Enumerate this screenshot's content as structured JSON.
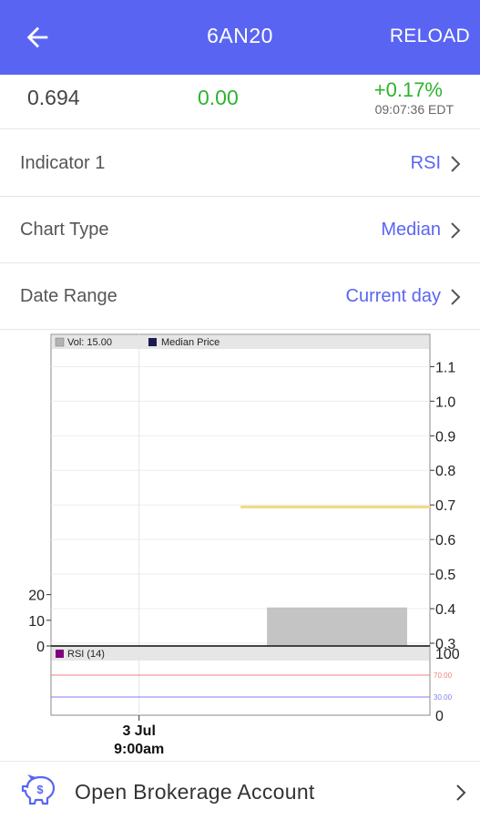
{
  "appbar": {
    "title": "6AN20",
    "reload_label": "RELOAD",
    "back_icon": "arrow-left-icon",
    "background": "#5965f2"
  },
  "quote": {
    "last": "0.694",
    "change": "0.00",
    "change_pct": "+0.17%",
    "time": "09:07:36 EDT",
    "positive_color": "#2db32d"
  },
  "settings": [
    {
      "label": "Indicator 1",
      "value": "RSI"
    },
    {
      "label": "Chart Type",
      "value": "Median"
    },
    {
      "label": "Date Range",
      "value": "Current day"
    }
  ],
  "chart_data": {
    "type": "line",
    "main_panel": {
      "legend": [
        {
          "name": "Vol: 15.00",
          "color": "#b3b3b3"
        },
        {
          "name": "Median Price",
          "color": "#1a1a4d"
        }
      ],
      "y_right_ticks": [
        "1.1",
        "1.0",
        "0.9",
        "0.8",
        "0.7",
        "0.6",
        "0.5",
        "0.4",
        "0.3"
      ],
      "ylim": [
        0.3,
        1.13
      ],
      "series": [
        {
          "name": "Median Price",
          "color": "#f0dc82",
          "x": [
            0.5,
            1.0
          ],
          "values": [
            0.694,
            0.694
          ]
        }
      ],
      "volume_left_ticks": [
        "20",
        "10",
        "0"
      ],
      "volume_ylim": [
        0,
        22
      ],
      "volume": [
        {
          "x_start": 0.57,
          "x_end": 0.94,
          "value": 15
        }
      ]
    },
    "rsi_panel": {
      "legend": [
        {
          "name": "RSI (14)",
          "color": "#800080"
        }
      ],
      "y_right_ticks": [
        "100",
        "0"
      ],
      "ylim": [
        0,
        100
      ],
      "levels": [
        {
          "label": "70.00",
          "value": 70,
          "color": "#f08080"
        },
        {
          "label": "30.00",
          "value": 30,
          "color": "#8080f0"
        }
      ]
    },
    "x_ticks": [
      {
        "date": "3 Jul",
        "time": "9:00am",
        "x": 0.25
      }
    ],
    "grid": true
  },
  "brokerage": {
    "label": "Open Brokerage Account",
    "icon": "piggy-bank-dollar-icon",
    "color": "#5965f2"
  }
}
